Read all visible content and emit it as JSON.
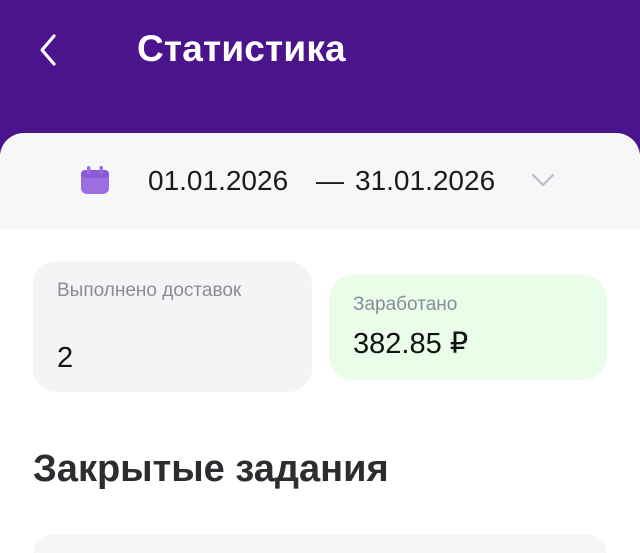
{
  "header": {
    "title": "Статистика",
    "back_icon": "chevron-left-icon"
  },
  "period": {
    "from": "01.01.2026",
    "separator": "—",
    "to": "31.01.2026",
    "calendar_icon": "calendar-icon",
    "dropdown_icon": "chevron-down-icon"
  },
  "stats": {
    "deliveries": {
      "label": "Выполнено доставок",
      "value": "2"
    },
    "earned": {
      "label": "Заработано",
      "value": "382.85 ₽"
    }
  },
  "closed_tasks": {
    "title": "Закрытые задания"
  },
  "colors": {
    "brand": "#4c148c",
    "calendar_icon": "#9c6fe0",
    "earned_card_bg": "#e9fde9"
  }
}
